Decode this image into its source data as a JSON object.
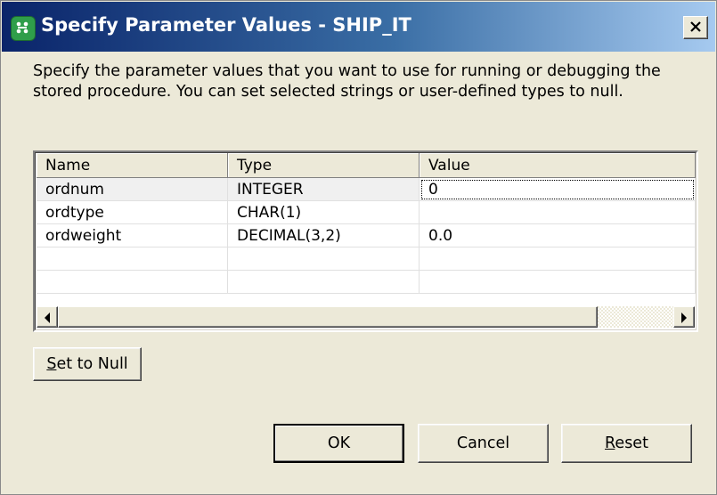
{
  "window": {
    "title": "Specify Parameter Values - SHIP_IT",
    "icon": "app-grid-icon",
    "close_icon": "close-x-icon"
  },
  "description": "Specify the parameter values that you want to use for running or debugging the stored procedure.  You can set selected strings or user-defined types to null.",
  "table": {
    "columns": [
      "Name",
      "Type",
      "Value"
    ],
    "rows": [
      {
        "name": "ordnum",
        "type": "INTEGER",
        "value": "0"
      },
      {
        "name": "ordtype",
        "type": "CHAR(1)",
        "value": ""
      },
      {
        "name": "ordweight",
        "type": "DECIMAL(3,2)",
        "value": "0.0"
      },
      {
        "name": "",
        "type": "",
        "value": ""
      },
      {
        "name": "",
        "type": "",
        "value": ""
      }
    ]
  },
  "buttons": {
    "set_to_null": {
      "mnemonic": "S",
      "rest": "et to Null"
    },
    "ok": "OK",
    "cancel": "Cancel",
    "reset": {
      "mnemonic": "R",
      "rest": "eset"
    }
  },
  "colors": {
    "title_bar_start": "#0a246a",
    "title_bar_end": "#a6caf0",
    "dialog_background": "#ece9d8"
  }
}
